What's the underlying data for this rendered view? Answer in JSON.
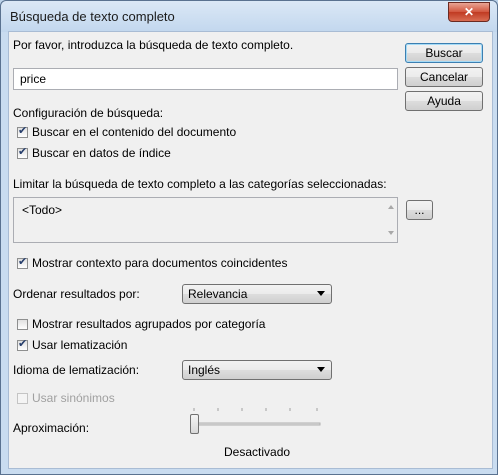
{
  "window": {
    "title": "Búsqueda de texto completo",
    "close_glyph": "✕"
  },
  "prompt": "Por favor, introduzca la búsqueda de texto completo.",
  "search": {
    "value": "price"
  },
  "buttons": {
    "search": "Buscar",
    "cancel": "Cancelar",
    "help": "Ayuda",
    "browse": "..."
  },
  "config": {
    "heading": "Configuración de búsqueda:",
    "content_label": "Buscar en el contenido del documento",
    "content_checked": true,
    "index_label": "Buscar en datos de índice",
    "index_checked": true
  },
  "categories": {
    "label": "Limitar la búsqueda de texto completo a las categorías seleccionadas:",
    "items": [
      "<Todo>"
    ]
  },
  "show_context": {
    "label": "Mostrar contexto para documentos coincidentes",
    "checked": true
  },
  "sort": {
    "label": "Ordenar resultados por:",
    "selected": "Relevancia"
  },
  "grouped": {
    "label": "Mostrar resultados agrupados por categoría",
    "checked": false
  },
  "lemmatization": {
    "label": "Usar lematización",
    "checked": true
  },
  "lemma_lang": {
    "label": "Idioma de lematización:",
    "selected": "Inglés"
  },
  "synonyms": {
    "label": "Usar sinónimos",
    "checked": false,
    "disabled": true
  },
  "approx": {
    "label": "Aproximación:",
    "value_label": "Desactivado",
    "level": 0
  }
}
